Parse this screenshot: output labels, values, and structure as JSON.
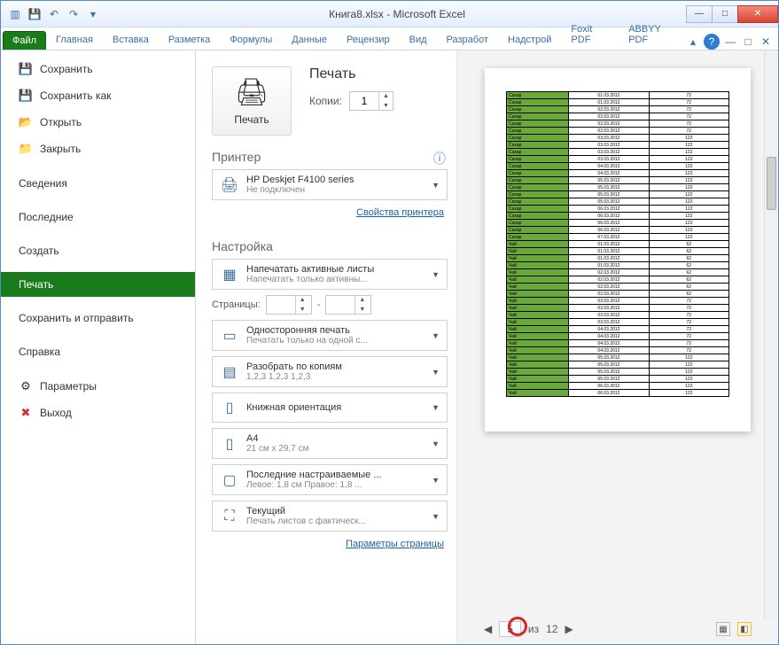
{
  "window": {
    "title": "Книга8.xlsx  -  Microsoft Excel"
  },
  "ribbon": {
    "tabs": [
      "Файл",
      "Главная",
      "Вставка",
      "Разметка",
      "Формулы",
      "Данные",
      "Рецензир",
      "Вид",
      "Разработ",
      "Надстрой",
      "Foxit PDF",
      "ABBYY PDF"
    ],
    "active": 0
  },
  "sidebar": {
    "items": [
      {
        "label": "Сохранить",
        "icon": "💾"
      },
      {
        "label": "Сохранить как",
        "icon": "💾"
      },
      {
        "label": "Открыть",
        "icon": "📂"
      },
      {
        "label": "Закрыть",
        "icon": "📁"
      }
    ],
    "items2": [
      {
        "label": "Сведения"
      },
      {
        "label": "Последние"
      },
      {
        "label": "Создать"
      },
      {
        "label": "Печать",
        "active": true
      },
      {
        "label": "Сохранить и отправить"
      },
      {
        "label": "Справка"
      }
    ],
    "items3": [
      {
        "label": "Параметры",
        "icon": "⚙"
      },
      {
        "label": "Выход",
        "icon": "✖"
      }
    ]
  },
  "print": {
    "heading": "Печать",
    "button": "Печать",
    "copies_label": "Копии:",
    "copies_value": "1",
    "printer_section": "Принтер",
    "printer_name": "HP Deskjet F4100 series",
    "printer_status": "Не подключен",
    "printer_props": "Свойства принтера",
    "settings_section": "Настройка",
    "dd1_t": "Напечатать активные листы",
    "dd1_s": "Напечатать только активны...",
    "pages_label": "Страницы:",
    "pages_sep": "-",
    "dd2_t": "Односторонняя печать",
    "dd2_s": "Печатать только на одной с...",
    "dd3_t": "Разобрать по копиям",
    "dd3_s": "1,2,3   1,2,3   1,2,3",
    "dd4_t": "Книжная ориентация",
    "dd5_t": "A4",
    "dd5_s": "21 см x 29,7 см",
    "dd6_t": "Последние настраиваемые ...",
    "dd6_s": "Левое: 1,8 см   Правое: 1,8 ...",
    "dd7_t": "Текущий",
    "dd7_s": "Печать листов с фактическ...",
    "page_setup": "Параметры страницы"
  },
  "preview": {
    "page_current": "5",
    "page_sep": "из",
    "page_total": "12",
    "rows": [
      [
        "Сахар",
        "01.03.2012",
        "72"
      ],
      [
        "Сахар",
        "01.03.2012",
        "72"
      ],
      [
        "Сахар",
        "02.03.2012",
        "72"
      ],
      [
        "Сахар",
        "02.03.2012",
        "72"
      ],
      [
        "Сахар",
        "02.03.2012",
        "72"
      ],
      [
        "Сахар",
        "02.03.2012",
        "72"
      ],
      [
        "Сахар",
        "03.03.2012",
        "122"
      ],
      [
        "Сахар",
        "03.03.2012",
        "122"
      ],
      [
        "Сахар",
        "03.03.2012",
        "122"
      ],
      [
        "Сахар",
        "03.03.2012",
        "122"
      ],
      [
        "Сахар",
        "04.03.2012",
        "122"
      ],
      [
        "Сахар",
        "04.03.2012",
        "122"
      ],
      [
        "Сахар",
        "05.03.2012",
        "122"
      ],
      [
        "Сахар",
        "05.03.2012",
        "122"
      ],
      [
        "Сахар",
        "05.03.2012",
        "122"
      ],
      [
        "Сахар",
        "05.03.2012",
        "122"
      ],
      [
        "Сахар",
        "06.03.2012",
        "122"
      ],
      [
        "Сахар",
        "06.03.2012",
        "122"
      ],
      [
        "Сахар",
        "06.03.2012",
        "122"
      ],
      [
        "Сахар",
        "06.03.2012",
        "122"
      ],
      [
        "Сахар",
        "07.03.2012",
        "122"
      ],
      [
        "Чай",
        "01.03.2012",
        "62"
      ],
      [
        "Чай",
        "01.03.2012",
        "62"
      ],
      [
        "Чай",
        "01.03.2012",
        "62"
      ],
      [
        "Чай",
        "01.03.2012",
        "62"
      ],
      [
        "Чай",
        "02.03.2012",
        "62"
      ],
      [
        "Чай",
        "02.03.2012",
        "62"
      ],
      [
        "Чай",
        "02.03.2012",
        "62"
      ],
      [
        "Чай",
        "02.03.2012",
        "62"
      ],
      [
        "Чай",
        "03.03.2012",
        "72"
      ],
      [
        "Чай",
        "03.03.2012",
        "72"
      ],
      [
        "Чай",
        "03.03.2012",
        "72"
      ],
      [
        "Чай",
        "03.03.2012",
        "72"
      ],
      [
        "Чай",
        "04.03.2012",
        "72"
      ],
      [
        "Чай",
        "04.03.2012",
        "72"
      ],
      [
        "Чай",
        "04.03.2012",
        "72"
      ],
      [
        "Чай",
        "04.03.2012",
        "72"
      ],
      [
        "Чай",
        "05.03.2012",
        "122"
      ],
      [
        "Чай",
        "05.03.2012",
        "122"
      ],
      [
        "Чай",
        "05.03.2012",
        "122"
      ],
      [
        "Чай",
        "05.03.2012",
        "122"
      ],
      [
        "Чай",
        "06.03.2012",
        "122"
      ],
      [
        "Чай",
        "06.03.2012",
        "122"
      ]
    ]
  }
}
